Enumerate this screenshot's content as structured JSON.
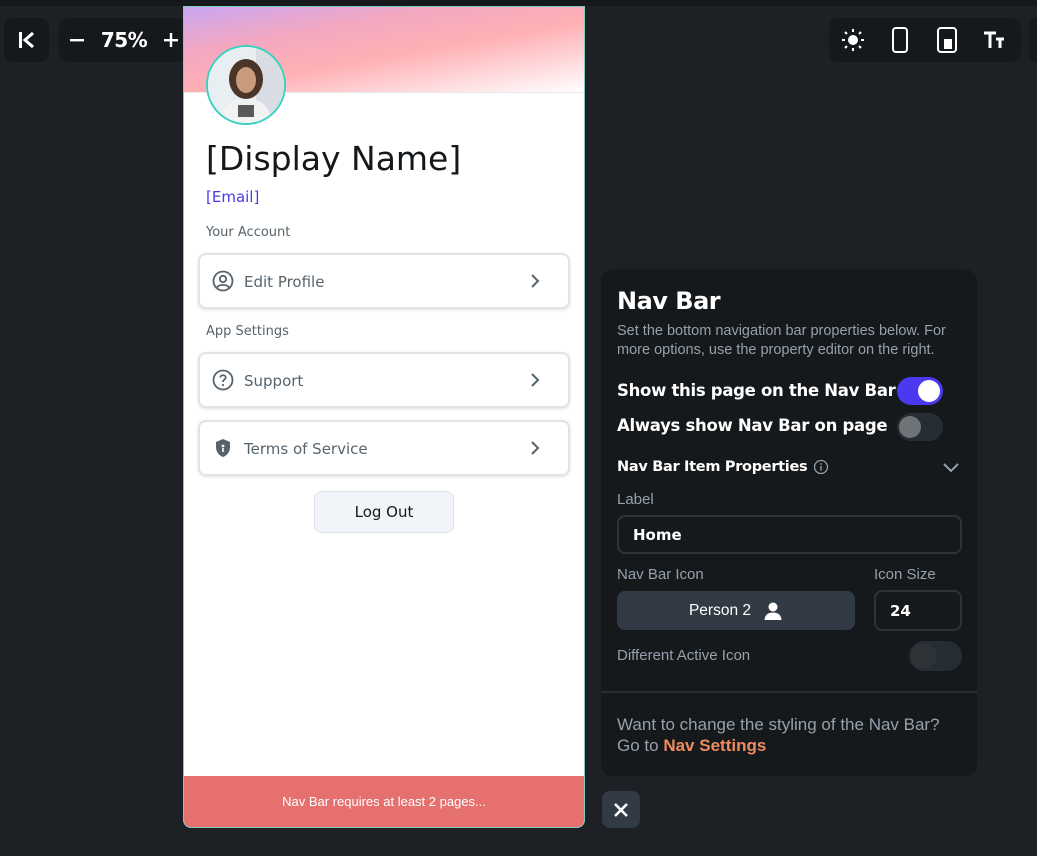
{
  "toolbar": {
    "zoom_label": "75%",
    "icons": [
      "collapse-sidebar-icon",
      "zoom-out-icon",
      "zoom-in-icon",
      "design-mode-icon",
      "theme-sun-icon",
      "phone-device-icon",
      "tablet-device-icon",
      "text-scale-icon"
    ]
  },
  "preview": {
    "display_name": "[Display Name]",
    "email": "[Email]",
    "section_account": "Your Account",
    "section_settings": "App Settings",
    "items": [
      {
        "label": "Edit Profile",
        "icon": "account-circle-icon"
      },
      {
        "label": "Support",
        "icon": "help-circle-icon"
      },
      {
        "label": "Terms of Service",
        "icon": "shield-icon"
      }
    ],
    "logout_label": "Log Out",
    "warning": "Nav Bar requires at least 2 pages..."
  },
  "panel": {
    "title": "Nav Bar",
    "description": "Set the bottom navigation bar properties below. For more options, use the property editor on the right.",
    "show_on_nav_label": "Show this page on the Nav Bar",
    "show_on_nav": true,
    "always_show_label": "Always show Nav Bar on page",
    "always_show": false,
    "item_props_label": "Nav Bar Item Properties",
    "label_field_label": "Label",
    "label_value": "Home",
    "icon_field_label": "Nav Bar Icon",
    "icon_value": "Person 2",
    "icon_size_label": "Icon Size",
    "icon_size_value": "24",
    "different_active_label": "Different Active Icon",
    "different_active": false,
    "footer_text": "Want to change the styling of the Nav Bar? Go to",
    "footer_link": "Nav Settings"
  },
  "colors": {
    "accent": "#4b39ef",
    "link": "#ee8b60",
    "warning": "#e5706e",
    "avatar_ring": "#39d2c0"
  }
}
